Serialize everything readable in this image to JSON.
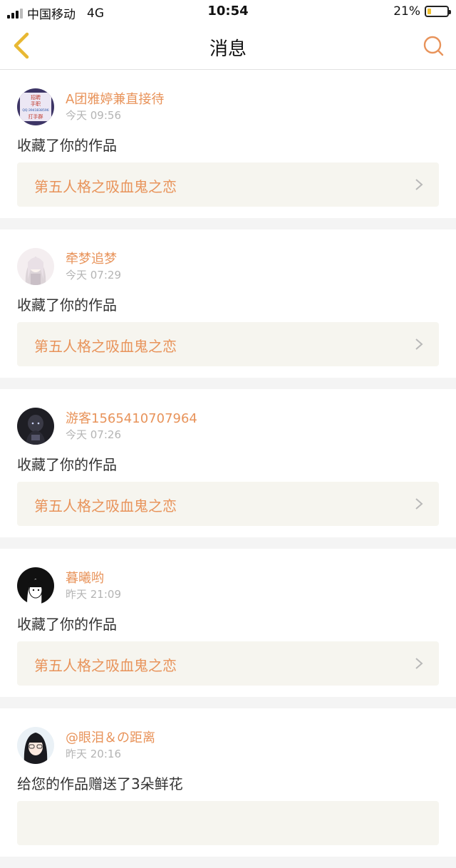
{
  "status_bar": {
    "carrier": "中国移动",
    "network": "4G",
    "time": "10:54",
    "battery_percent": "21%",
    "battery_level": 0.21
  },
  "header": {
    "title": "消息",
    "back_icon": "chevron-left-icon",
    "search_icon": "search-icon"
  },
  "colors": {
    "accent": "#e8935a",
    "back_arrow": "#e8b833",
    "card_bg": "#ffffff",
    "link_bg": "#f6f5ef"
  },
  "notifications": [
    {
      "username": "A团雅婷兼直接待",
      "time": "今天 09:56",
      "message": "收藏了你的作品",
      "work_title": "第五人格之吸血鬼之恋",
      "avatar_text": [
        "招聘",
        "手职",
        "QQ:3941838596",
        "打手群"
      ]
    },
    {
      "username": "牵梦追梦",
      "time": "今天 07:29",
      "message": "收藏了你的作品",
      "work_title": "第五人格之吸血鬼之恋"
    },
    {
      "username": "游客1565410707964",
      "time": "今天 07:26",
      "message": "收藏了你的作品",
      "work_title": "第五人格之吸血鬼之恋"
    },
    {
      "username": "暮曦哟",
      "time": "昨天 21:09",
      "message": "收藏了你的作品",
      "work_title": "第五人格之吸血鬼之恋"
    },
    {
      "username": "@眼泪＆の距离",
      "time": "昨天 20:16",
      "message": "给您的作品赠送了3朵鲜花",
      "work_title": ""
    }
  ]
}
